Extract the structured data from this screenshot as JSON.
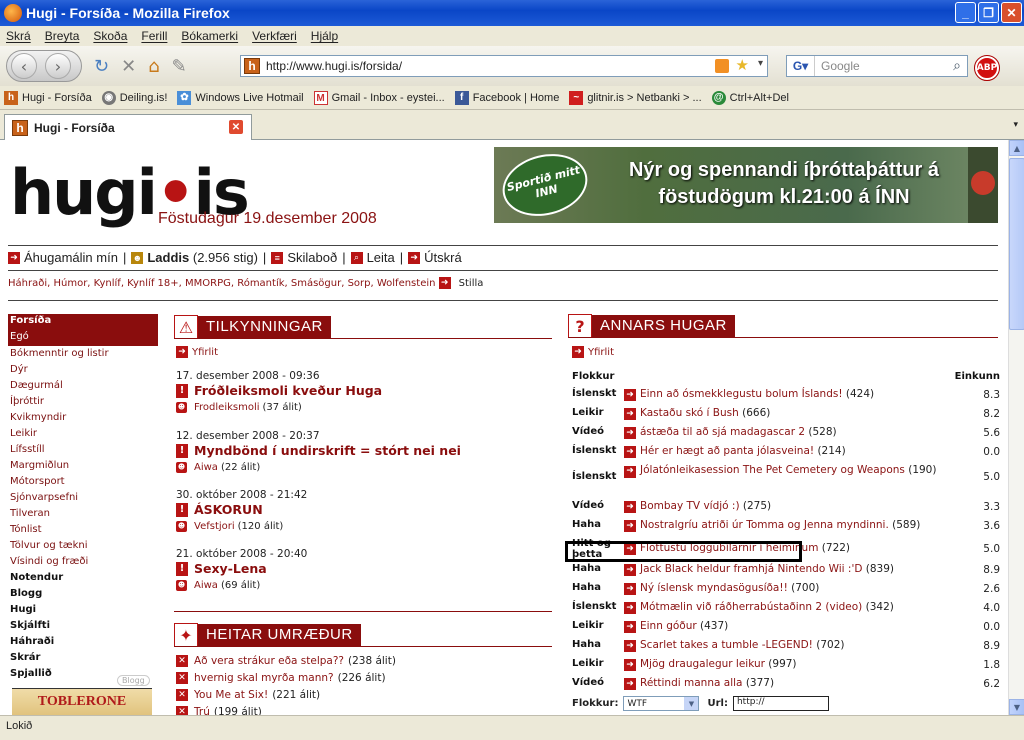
{
  "window": {
    "title": "Hugi - Forsíða - Mozilla Firefox"
  },
  "menu": [
    "Skrá",
    "Breyta",
    "Skoða",
    "Ferill",
    "Bókamerki",
    "Verkfæri",
    "Hjálp"
  ],
  "url": "http://www.hugi.is/forsida/",
  "search_placeholder": "Google",
  "abp": "ABP",
  "bookmarks": [
    "Hugi - Forsíða",
    "Deiling.is!",
    "Windows Live Hotmail",
    "Gmail - Inbox - eystei...",
    "Facebook | Home",
    "glitnir.is > Netbanki > ...",
    "Ctrl+Alt+Del"
  ],
  "tab": {
    "title": "Hugi - Forsíða"
  },
  "status": "Lokið",
  "site": {
    "logo_left": "hugi",
    "logo_dot": "•",
    "logo_right": "is",
    "date": "Föstudagur 19.desember 2008",
    "banner_badge": "Sportið mitt INN",
    "banner_text": "Nýr og spennandi íþróttaþáttur á föstudögum kl.21:00 á ÍNN"
  },
  "userbar": {
    "my_interests": "Áhugamálin mín",
    "user": "Laddis",
    "points": "(2.956 stig)",
    "messages": "Skilaboð",
    "search": "Leita",
    "logout": "Útskrá"
  },
  "favorites": {
    "list": "Háhraði, Húmor, Kynlíf, Kynlíf 18+, MMORPG, Rómantík, Smásögur, Sorp, Wolfenstein",
    "settings": "Stilla"
  },
  "leftnav": {
    "selected": "Forsíða",
    "highlighted": "Egó",
    "items": [
      "Bókmenntir og listir",
      "Dýr",
      "Dægurmál",
      "Íþróttir",
      "Kvikmyndir",
      "Leikir",
      "Lífsstíll",
      "Margmiðlun",
      "Mótorsport",
      "Sjónvarpsefni",
      "Tilveran",
      "Tónlist",
      "Tölvur og tækni",
      "Vísindi og fræði"
    ],
    "bold_items": [
      "Notendur",
      "Blogg",
      "Hugi",
      "Skjálfti",
      "Háhraði",
      "Skrár",
      "Spjallið"
    ],
    "blog_badge": "Blogg",
    "ad": "TOBLERONE"
  },
  "announcements": {
    "title": "TILKYNNINGAR",
    "overview": "Yfirlit",
    "items": [
      {
        "date": "17. desember 2008 - 09:36",
        "headline": "Fróðleiksmoli kveður Huga",
        "author": "Frodleiksmoli",
        "comments": "(37 álit)"
      },
      {
        "date": "12. desember 2008 - 20:37",
        "headline": "Myndbönd í undirskrift = stórt nei nei",
        "author": "Aiwa",
        "comments": "(22 álit)"
      },
      {
        "date": "30. október 2008 - 21:42",
        "headline": "ÁSKORUN",
        "author": "Vefstjori",
        "comments": "(120 álit)"
      },
      {
        "date": "21. október 2008 - 20:40",
        "headline": "Sexy-Lena",
        "author": "Aiwa",
        "comments": "(69 álit)"
      }
    ]
  },
  "hot_discussions": {
    "title": "HEITAR UMRÆÐUR",
    "items": [
      {
        "title": "Að vera strákur eða stelpa??",
        "count": "(238 álit)"
      },
      {
        "title": "hvernig skal myrða mann?",
        "count": "(226 álit)"
      },
      {
        "title": "You Me at Six!",
        "count": "(221 álit)"
      },
      {
        "title": "Trú",
        "count": "(199 álit)"
      }
    ]
  },
  "others": {
    "title": "ANNARS HUGAR",
    "overview": "Yfirlit",
    "col_category": "Flokkur",
    "col_rating": "Einkunn",
    "rows": [
      {
        "cat": "Íslenskt",
        "title": "Einn að ósmekklegustu bolum Íslands!",
        "count": "(424)",
        "score": "8.3"
      },
      {
        "cat": "Leikir",
        "title": "Kastaðu skó í Bush",
        "count": "(666)",
        "score": "8.2"
      },
      {
        "cat": "Vídeó",
        "title": "ástæða til að sjá madagascar 2",
        "count": "(528)",
        "score": "5.6"
      },
      {
        "cat": "Íslenskt",
        "title": "Hér er hægt að panta jólasveina!",
        "count": "(214)",
        "score": "0.0"
      },
      {
        "cat": "Íslenskt",
        "title": "Jólatónleikasession The Pet Cemetery og Weapons",
        "count": "(190)",
        "score": "5.0"
      },
      {
        "cat": "Vídeó",
        "title": "Bombay TV vídjó :)",
        "count": "(275)",
        "score": "3.3"
      },
      {
        "cat": "Haha",
        "title": "Nostralgríu atriði úr Tomma og Jenna myndinni.",
        "count": "(589)",
        "score": "3.6"
      },
      {
        "cat": "Hitt og þetta",
        "title": "Flottustu löggubílarnir í heiminum",
        "count": "(722)",
        "score": "5.0"
      },
      {
        "cat": "Haha",
        "title": "Jack Black heldur framhjá Nintendo Wii :'D",
        "count": "(839)",
        "score": "8.9"
      },
      {
        "cat": "Haha",
        "title": "Ný íslensk myndasögusíða!!",
        "count": "(700)",
        "score": "2.6"
      },
      {
        "cat": "Íslenskt",
        "title": "Mótmælin við ráðherrabústaðinn 2 (video)",
        "count": "(342)",
        "score": "4.0"
      },
      {
        "cat": "Leikir",
        "title": "Einn góður",
        "count": "(437)",
        "score": "0.0"
      },
      {
        "cat": "Haha",
        "title": "Scarlet takes a tumble -LEGEND!",
        "count": "(702)",
        "score": "8.9"
      },
      {
        "cat": "Leikir",
        "title": "Mjög draugalegur leikur",
        "count": "(997)",
        "score": "1.8"
      },
      {
        "cat": "Vídeó",
        "title": "Réttindi manna alla",
        "count": "(377)",
        "score": "6.2"
      }
    ],
    "form": {
      "category_label": "Flokkur:",
      "category_value": "WTF",
      "url_label": "Url:",
      "url_value": "http://"
    }
  }
}
